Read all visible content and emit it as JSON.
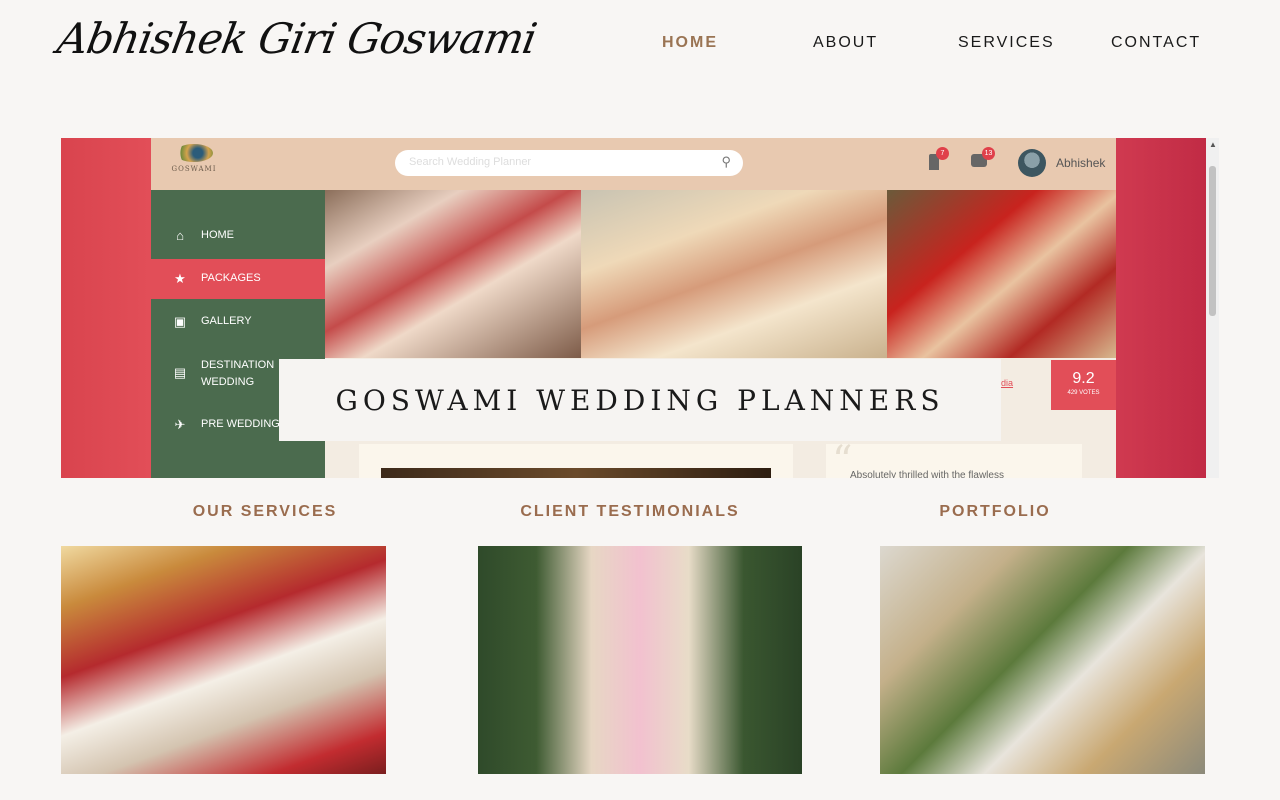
{
  "header": {
    "signature": "Abhishek Giri Goswami",
    "nav": [
      {
        "label": "HOME",
        "active": true
      },
      {
        "label": "ABOUT",
        "active": false
      },
      {
        "label": "SERVICES",
        "active": false
      },
      {
        "label": "CONTACT",
        "active": false
      }
    ]
  },
  "hero": {
    "topbar": {
      "logo_text": "GOSWAMI",
      "search_placeholder": "Search Wedding Planner",
      "bookmark_count": "7",
      "message_count": "13",
      "user_name": "Abhishek"
    },
    "sidebar": [
      {
        "label": "HOME",
        "icon": "home-icon"
      },
      {
        "label": "PACKAGES",
        "icon": "star-icon",
        "active": true
      },
      {
        "label": "GALLERY",
        "icon": "image-icon"
      },
      {
        "label": "DESTINATION WEDDING",
        "icon": "map-icon"
      },
      {
        "label": "PRE WEDDING",
        "icon": "plane-icon"
      }
    ],
    "title": "GOSWAMI WEDDING PLANNERS",
    "location": "r, India",
    "rating": {
      "score": "9.2",
      "votes": "429 VOTES"
    },
    "review_snippet": "Absolutely thrilled with the flawless"
  },
  "sections": {
    "services": "OUR SERVICES",
    "testimonials": "CLIENT TESTIMONIALS",
    "portfolio": "PORTFOLIO"
  },
  "colors": {
    "accent_brown": "#9a7453",
    "sidebar_green": "#4b6b4e",
    "active_red": "#e24e58",
    "topbar_peach": "#e8c9b0",
    "page_bg": "#f8f6f4"
  }
}
